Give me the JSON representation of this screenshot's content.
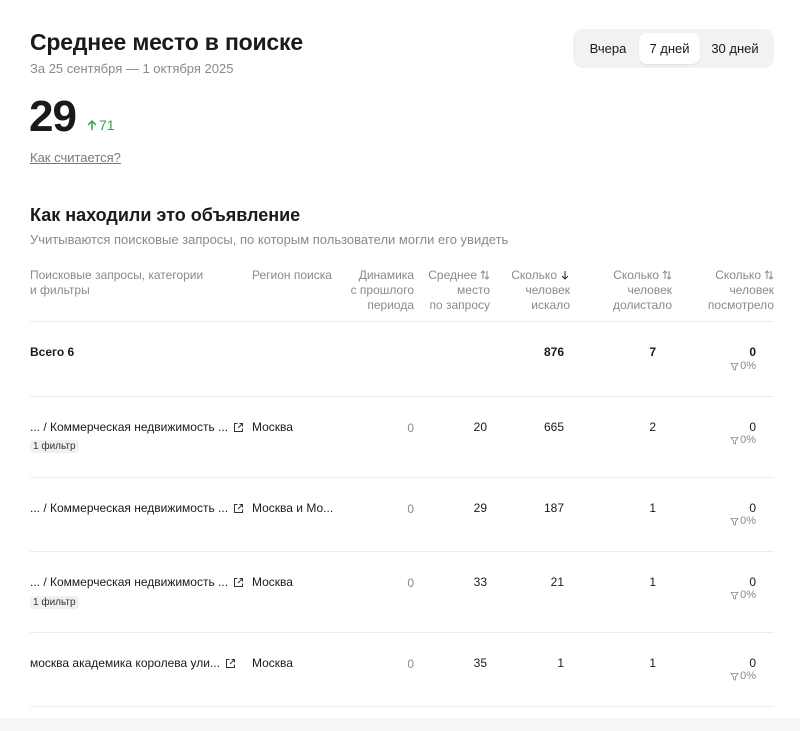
{
  "header": {
    "title": "Среднее место в поиске",
    "subtitle": "За 25 сентября — 1 октября 2025"
  },
  "period_toggle": {
    "options": [
      "Вчера",
      "7 дней",
      "30 дней"
    ],
    "selected": "7 дней"
  },
  "summary": {
    "value": "29",
    "delta": "71",
    "delta_color": "#2fa14a",
    "how_link": "Как считается?"
  },
  "section": {
    "title": "Как находили это объявление",
    "subtitle": "Учитываются поисковые запросы, по которым пользователи могли его увидеть"
  },
  "table": {
    "headers": {
      "query": [
        "Поисковые запросы, категории",
        "и фильтры"
      ],
      "region": [
        "Регион поиска"
      ],
      "dynamics": [
        "Динамика",
        "с прошлого",
        "периода"
      ],
      "avg_place": [
        "Среднее",
        "место",
        "по запросу"
      ],
      "searched": [
        "Сколько",
        "человек",
        "искало"
      ],
      "scrolled": [
        "Сколько",
        "человек",
        "долистало"
      ],
      "viewed": [
        "Сколько",
        "человек",
        "посмотрело"
      ]
    },
    "total": {
      "label": "Всего 6",
      "searched": "876",
      "scrolled": "7",
      "viewed": "0",
      "viewed_pct": "0%"
    },
    "rows": [
      {
        "query": "... / Коммерческая недвижимость ...",
        "filter": "1 фильтр",
        "region": "Москва",
        "dynamics": "0",
        "avg_place": "20",
        "searched": "665",
        "scrolled": "2",
        "viewed": "0",
        "viewed_pct": "0%"
      },
      {
        "query": "... / Коммерческая недвижимость ...",
        "filter": "",
        "region": "Москва и Мо...",
        "dynamics": "0",
        "avg_place": "29",
        "searched": "187",
        "scrolled": "1",
        "viewed": "0",
        "viewed_pct": "0%"
      },
      {
        "query": "... / Коммерческая недвижимость ...",
        "filter": "1 фильтр",
        "region": "Москва",
        "dynamics": "0",
        "avg_place": "33",
        "searched": "21",
        "scrolled": "1",
        "viewed": "0",
        "viewed_pct": "0%"
      },
      {
        "query": "москва академика королева ули...",
        "filter": "",
        "region": "Москва",
        "dynamics": "0",
        "avg_place": "35",
        "searched": "1",
        "scrolled": "1",
        "viewed": "0",
        "viewed_pct": "0%"
      }
    ]
  },
  "icons": {
    "delta": "arrow-up-icon",
    "sort": "sort-arrows-icon",
    "sort_active": "arrow-down-icon",
    "external": "external-link-icon",
    "funnel": "funnel-icon"
  }
}
